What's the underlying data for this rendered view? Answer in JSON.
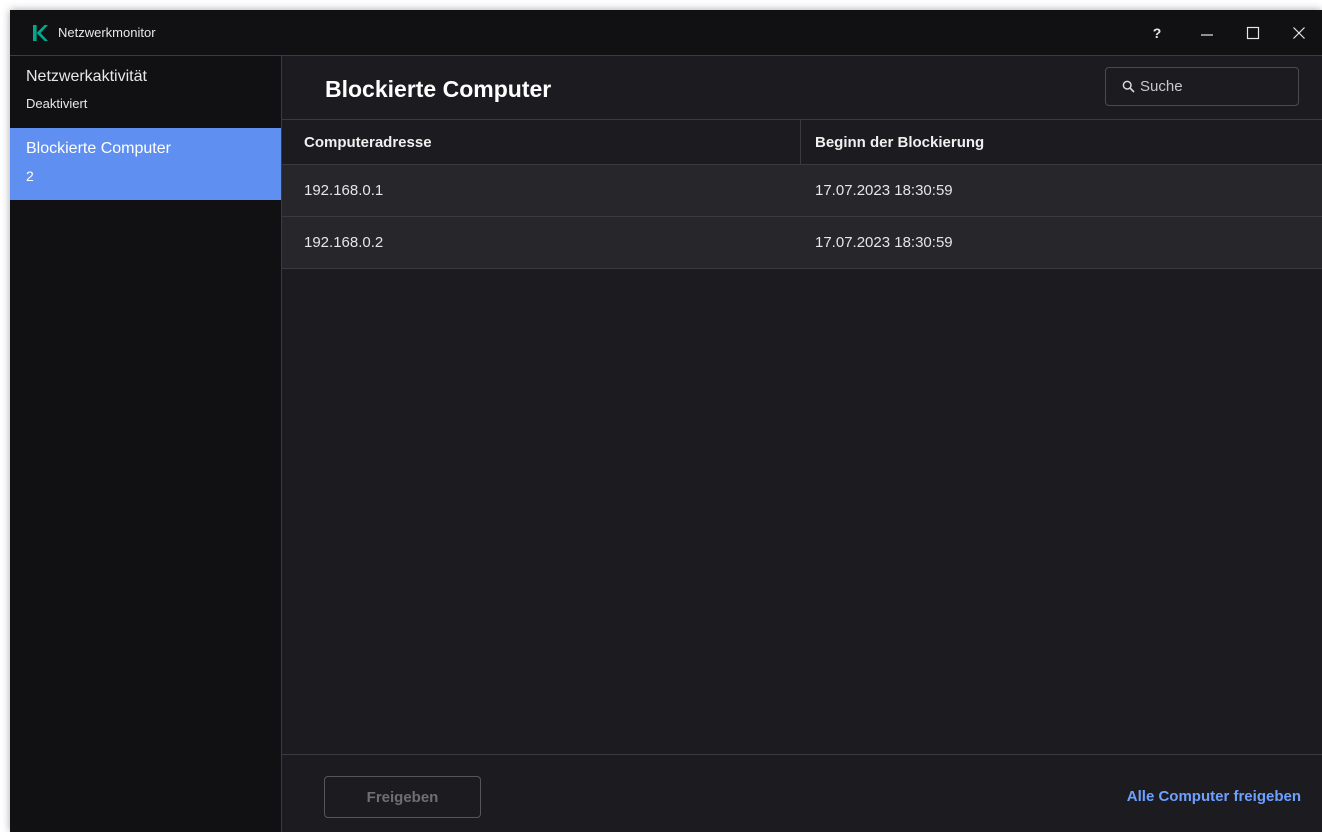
{
  "window": {
    "title": "Netzwerkmonitor",
    "controls": {
      "help": "?"
    }
  },
  "sidebar": {
    "items": [
      {
        "label": "Netzwerkaktivität",
        "sub": "Deaktiviert",
        "active": false
      },
      {
        "label": "Blockierte Computer",
        "sub": "2",
        "active": true
      }
    ]
  },
  "main": {
    "title": "Blockierte Computer",
    "search": {
      "placeholder": "Suche",
      "value": ""
    },
    "table": {
      "columns": [
        "Computeradresse",
        "Beginn der Blockierung"
      ],
      "rows": [
        [
          "192.168.0.1",
          "17.07.2023 18:30:59"
        ],
        [
          "192.168.0.2",
          "17.07.2023 18:30:59"
        ]
      ]
    },
    "footer": {
      "release_label": "Freigeben",
      "release_all_label": "Alle Computer freigeben"
    }
  },
  "colors": {
    "accent": "#5f8ff0",
    "link": "#6ea0ff",
    "logo": "#00a88e",
    "background": "#1c1c20",
    "sidebar_background": "#111113"
  },
  "icons": {
    "logo": "kaspersky-k-logo",
    "search": "search-icon",
    "minimize": "minimize-icon",
    "maximize": "maximize-icon",
    "close": "close-icon"
  }
}
